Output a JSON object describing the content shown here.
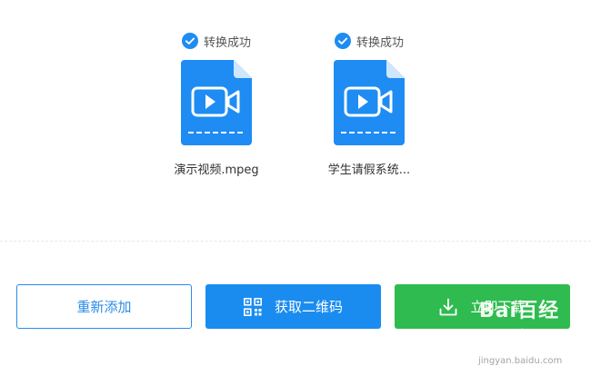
{
  "files": [
    {
      "status": "转换成功",
      "name": "演示视频.mpeg",
      "icon": "video-file-icon"
    },
    {
      "status": "转换成功",
      "name": "学生请假系统...",
      "icon": "video-file-icon"
    }
  ],
  "buttons": {
    "readd": "重新添加",
    "qrcode": "获取二维码",
    "download": "立即下载"
  },
  "watermark": {
    "logo": "Bai百经验",
    "url": "jingyan.baidu.com"
  },
  "colors": {
    "accent_blue": "#1a8cf0",
    "success_green": "#2fbb4f",
    "file_blue": "#1e8cf3"
  }
}
